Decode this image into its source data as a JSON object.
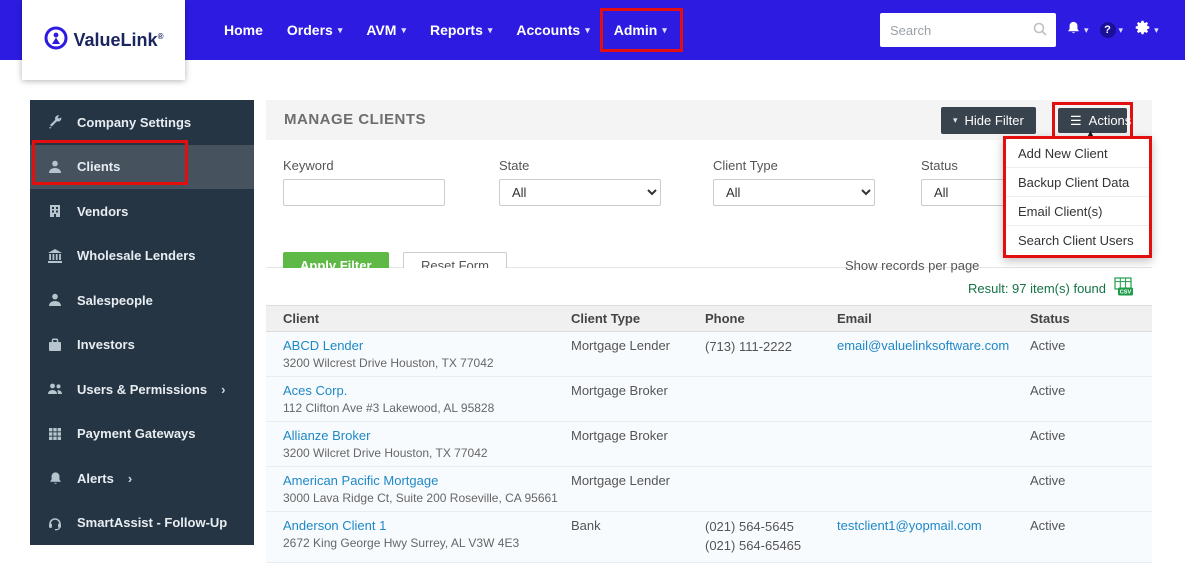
{
  "colors": {
    "navbar_blue": "#2d1be2",
    "sidebar_dark": "#253544",
    "accent_green": "#5fb946",
    "link_blue": "#1e88c7",
    "annotation_red": "#e50e0e",
    "result_green": "#157347"
  },
  "navbar": {
    "brand": "ValueLink",
    "brand_mark": "®",
    "items": [
      {
        "label": "Home"
      },
      {
        "label": "Orders"
      },
      {
        "label": "AVM"
      },
      {
        "label": "Reports"
      },
      {
        "label": "Accounts"
      },
      {
        "label": "Admin",
        "highlighted": true
      }
    ],
    "search_placeholder": "Search",
    "help_glyph": "?"
  },
  "sidebar": {
    "items": [
      {
        "label": "Company Settings",
        "icon": "tools-icon"
      },
      {
        "label": "Clients",
        "icon": "person-icon",
        "active": true,
        "highlighted": true
      },
      {
        "label": "Vendors",
        "icon": "building-icon"
      },
      {
        "label": "Wholesale Lenders",
        "icon": "bank-icon"
      },
      {
        "label": "Salespeople",
        "icon": "person-icon"
      },
      {
        "label": "Investors",
        "icon": "briefcase-icon"
      },
      {
        "label": "Users & Permissions",
        "icon": "users-icon",
        "expandable": true
      },
      {
        "label": "Payment Gateways",
        "icon": "keypad-icon"
      },
      {
        "label": "Alerts",
        "icon": "bell-icon",
        "expandable": true
      },
      {
        "label": "SmartAssist - Follow-Up",
        "icon": "headset-icon"
      }
    ],
    "chevron_glyph": "›"
  },
  "main": {
    "title": "MANAGE CLIENTS",
    "hide_filter_label": "Hide Filter",
    "actions_label": "Actions",
    "actions_menu": [
      "Add New Client",
      "Backup Client Data",
      "Email Client(s)",
      "Search Client Users"
    ],
    "filter": {
      "keyword_label": "Keyword",
      "keyword_value": "",
      "state_label": "State",
      "client_type_label": "Client Type",
      "status_label": "Status",
      "select_value": "All",
      "apply_label": "Apply Filter",
      "reset_label": "Reset Form",
      "show_records_label": "Show records per page"
    },
    "result_text": "Result: 97 item(s) found",
    "csv_label": "CSV",
    "table": {
      "columns": [
        "Client",
        "Client Type",
        "Phone",
        "Email",
        "Status"
      ],
      "rows": [
        {
          "client": "ABCD Lender",
          "address": "3200 Wilcrest Drive Houston, TX 77042",
          "client_type": "Mortgage Lender",
          "phone": "(713) 111-2222",
          "phone2": "",
          "email": "email@valuelinksoftware.com",
          "status": "Active"
        },
        {
          "client": "Aces Corp.",
          "address": "112 Clifton Ave #3 Lakewood, AL 95828",
          "client_type": "Mortgage Broker",
          "phone": "",
          "phone2": "",
          "email": "",
          "status": "Active"
        },
        {
          "client": "Allianze Broker",
          "address": "3200 Wilcret Drive Houston, TX 77042",
          "client_type": "Mortgage Broker",
          "phone": "",
          "phone2": "",
          "email": "",
          "status": "Active"
        },
        {
          "client": "American Pacific Mortgage",
          "address": "3000 Lava Ridge Ct, Suite 200 Roseville, CA 95661",
          "client_type": "Mortgage Lender",
          "phone": "",
          "phone2": "",
          "email": "",
          "status": "Active"
        },
        {
          "client": "Anderson Client 1",
          "address": "2672 King George Hwy Surrey, AL V3W 4E3",
          "client_type": "Bank",
          "phone": "(021) 564-5645",
          "phone2": "(021) 564-65465",
          "email": "testclient1@yopmail.com",
          "status": "Active"
        }
      ]
    }
  }
}
